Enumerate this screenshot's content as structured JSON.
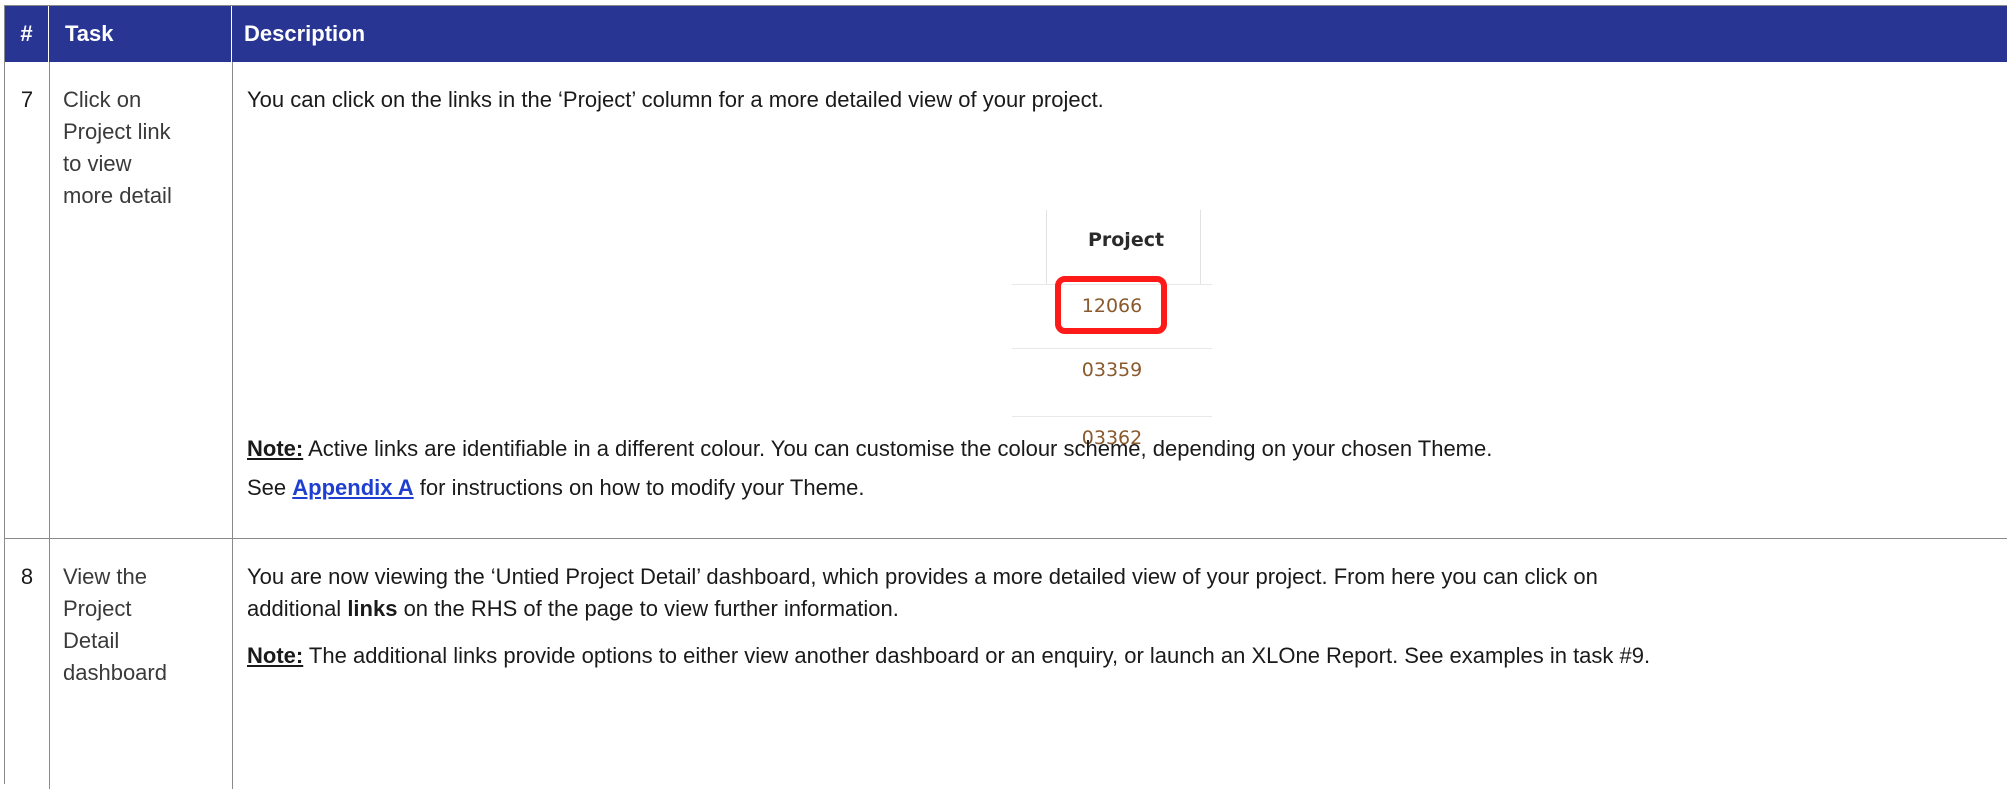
{
  "header": {
    "num": "#",
    "task": "Task",
    "description": "Description"
  },
  "rows": [
    {
      "num": "7",
      "task_lines": [
        "Click on",
        "Project link",
        "to view",
        "more detail"
      ],
      "desc_line1": "You can click on the links in the ‘Project’ column for a more detailed view of your project.",
      "image": {
        "column_header": "Project",
        "values": [
          "12066",
          "03359",
          "03362"
        ],
        "highlighted": "12066"
      },
      "note_label": "Note:",
      "note_text": " Active links are identifiable in a different colour. You can customise the colour scheme, depending on your chosen Theme.",
      "see_prefix": "See ",
      "see_link": "Appendix A",
      "see_suffix": " for instructions on how to modify your Theme."
    },
    {
      "num": "8",
      "task_lines": [
        "View the",
        "Project",
        "Detail",
        "dashboard"
      ],
      "desc_line1": "You are now viewing the ‘Untied Project Detail’ dashboard, which provides a more detailed view of your project. From here you can click on",
      "desc_line2_prefix": "additional ",
      "desc_line2_bold": "links",
      "desc_line2_suffix": " on the RHS of the page to view further information.",
      "note_label": "Note:",
      "note_text": " The additional links provide options to either view another dashboard or an enquiry, or launch an XLOne Report. See examples in task  #9."
    }
  ],
  "colors": {
    "header_bg": "#293593",
    "link": "#1f3fd1",
    "project_link": "#8a5a2e",
    "highlight": "#ff1a1a"
  }
}
